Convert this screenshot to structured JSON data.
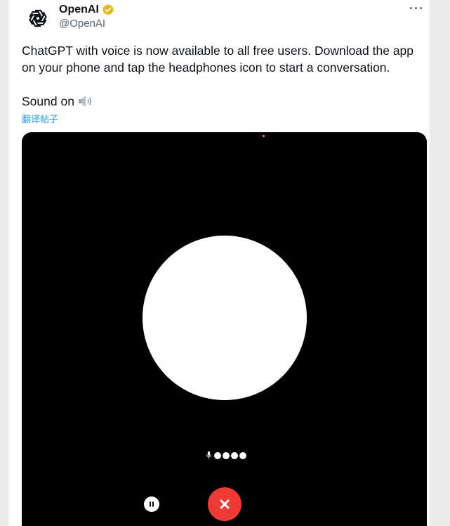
{
  "tweet": {
    "author": {
      "display_name": "OpenAI",
      "handle": "@OpenAI",
      "verified": true,
      "avatar_icon": "openai-logo-icon"
    },
    "more_icon": "more-options-icon",
    "more_label": "···",
    "text": "ChatGPT with voice is now available to all free users. Download the app on your phone and tap the headphones icon to start a conversation.",
    "sound_label": "Sound on",
    "sound_icon": "speaker-icon",
    "translate_label": "翻译帖子"
  },
  "media": {
    "background": "#000000",
    "orb_color": "#ffffff",
    "indicator": {
      "icon": "microphone-icon",
      "dot_count": 4
    },
    "controls": {
      "pause_icon": "pause-icon",
      "end_call_icon": "close-icon",
      "end_call_color": "#ee3a33"
    }
  },
  "colors": {
    "text_primary": "#0f1419",
    "text_secondary": "#536471",
    "link": "#1d9bf0",
    "verified_badge": "#e2b719"
  }
}
